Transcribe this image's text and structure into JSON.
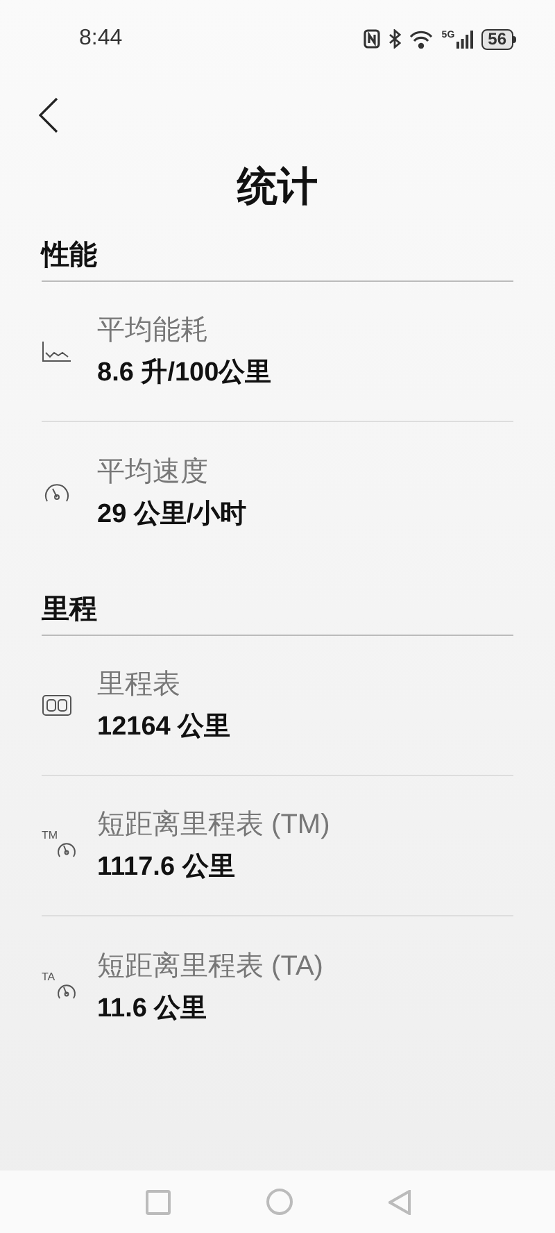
{
  "status_bar": {
    "time": "8:44",
    "battery": "56",
    "network": "5G"
  },
  "header": {
    "title": "统计"
  },
  "sections": [
    {
      "title": "性能",
      "items": [
        {
          "kind": "chart",
          "label": "平均能耗",
          "value": "8.6 升/100公里"
        },
        {
          "kind": "speed",
          "label": "平均速度",
          "value": "29 公里/小时"
        }
      ]
    },
    {
      "title": "里程",
      "items": [
        {
          "kind": "odometer",
          "label": "里程表",
          "value": "12164 公里"
        },
        {
          "kind": "trip",
          "icon_label": "TM",
          "label": "短距离里程表 (TM)",
          "value": "1117.6 公里"
        },
        {
          "kind": "trip",
          "icon_label": "TA",
          "label": "短距离里程表 (TA)",
          "value": "11.6 公里"
        }
      ]
    }
  ]
}
